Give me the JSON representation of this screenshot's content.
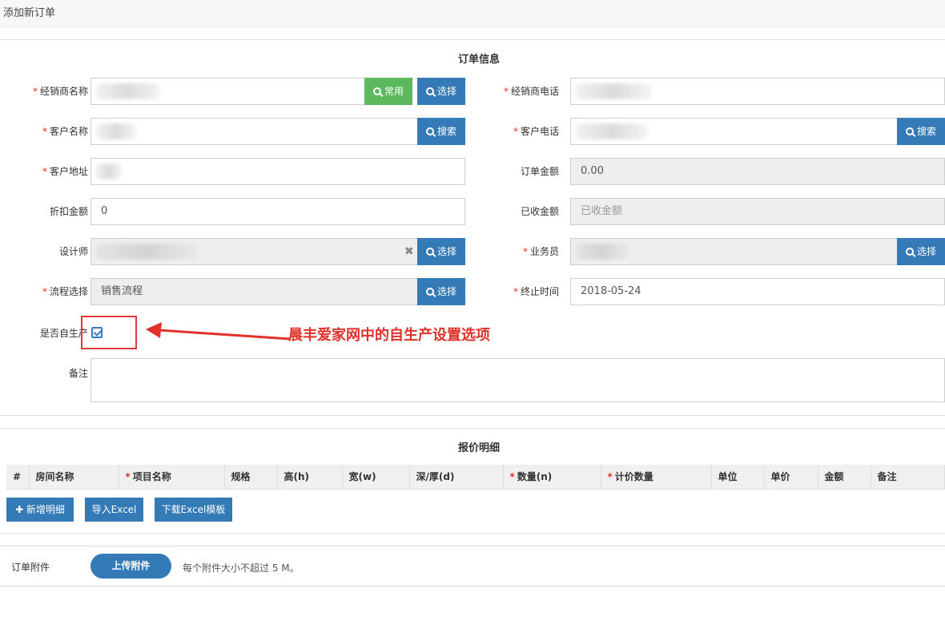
{
  "header": {
    "title": "添加新订单"
  },
  "order_info": {
    "title": "订单信息",
    "dealer_name": {
      "label": "经销商名称",
      "common_btn": "常用",
      "select_btn": "选择"
    },
    "dealer_phone": {
      "label": "经销商电话"
    },
    "customer_name": {
      "label": "客户名称",
      "search_btn": "搜索"
    },
    "customer_phone": {
      "label": "客户电话",
      "search_btn": "搜索"
    },
    "customer_address": {
      "label": "客户地址"
    },
    "order_amount": {
      "label": "订单金额",
      "value": "0.00"
    },
    "discount_amount": {
      "label": "折扣金额",
      "value": "0"
    },
    "received_amount": {
      "label": "已收金额",
      "placeholder": "已收金额"
    },
    "designer": {
      "label": "设计师",
      "clear": "✖",
      "select_btn": "选择"
    },
    "salesperson": {
      "label": "业务员",
      "select_btn": "选择"
    },
    "process": {
      "label": "流程选择",
      "value": "销售流程",
      "select_btn": "选择"
    },
    "end_time": {
      "label": "终止时间",
      "value": "2018-05-24"
    },
    "self_produce": {
      "label": "是否自生产",
      "checked": true
    },
    "remark": {
      "label": "备注"
    },
    "required_mark": "*"
  },
  "annotation": {
    "text": "晨丰爱家网中的自生产设置选项",
    "color": "#e0312b"
  },
  "quote_detail": {
    "title": "报价明细",
    "columns": [
      {
        "label": "#",
        "required": false
      },
      {
        "label": "房间名称",
        "required": false
      },
      {
        "label": "项目名称",
        "required": true
      },
      {
        "label": "规格",
        "required": false
      },
      {
        "label": "高(h)",
        "required": false
      },
      {
        "label": "宽(w)",
        "required": false
      },
      {
        "label": "深/厚(d)",
        "required": false
      },
      {
        "label": "数量(n)",
        "required": true
      },
      {
        "label": "计价数量",
        "required": true
      },
      {
        "label": "单位",
        "required": false
      },
      {
        "label": "单价",
        "required": false
      },
      {
        "label": "金额",
        "required": false
      },
      {
        "label": "备注",
        "required": false
      }
    ],
    "add_btn": "✚ 新增明细",
    "import_btn": "导入Excel",
    "download_btn": "下载Excel模板"
  },
  "attachments": {
    "label": "订单附件",
    "upload_btn": "上传附件",
    "hint": "每个附件大小不超过 5 M。"
  },
  "colors": {
    "primary": "#337ab7",
    "success": "#5cb85c",
    "required": "#e0312b"
  }
}
